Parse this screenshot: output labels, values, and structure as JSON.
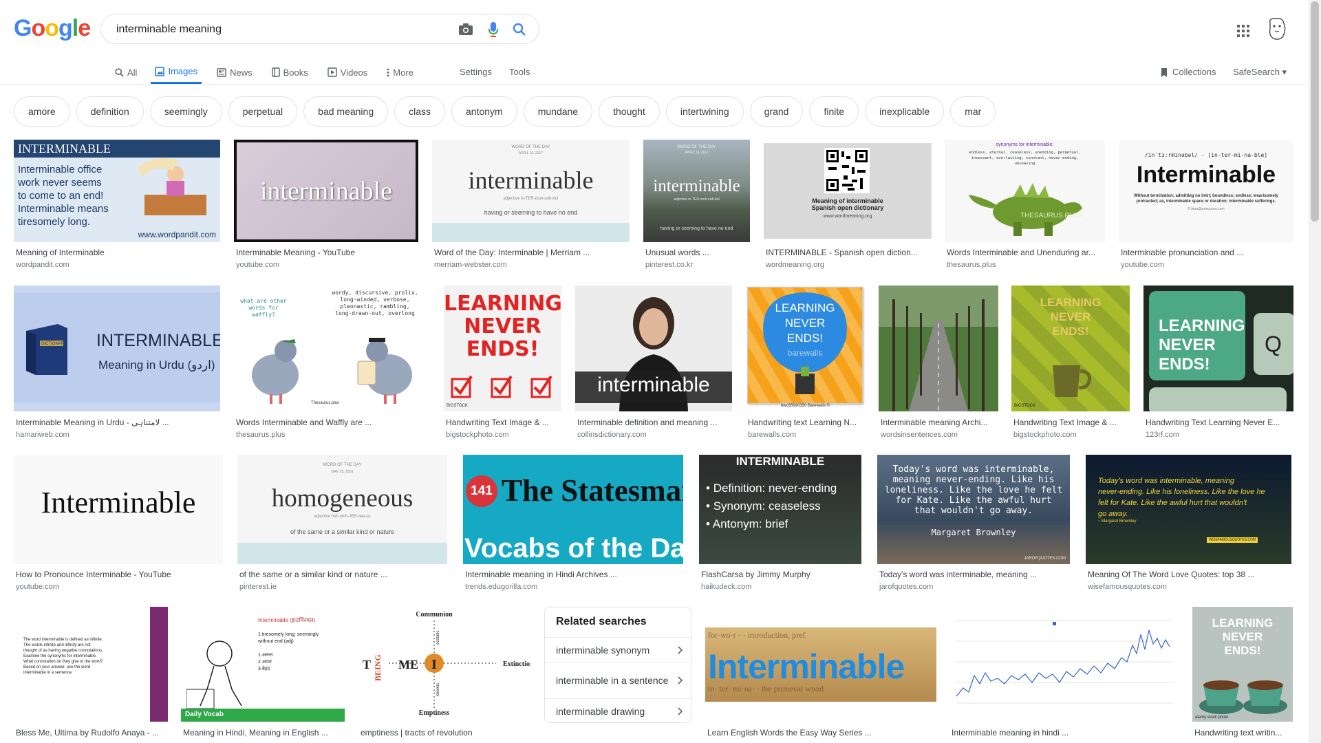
{
  "search": {
    "value": "interminable meaning"
  },
  "logo": {
    "letters": [
      "G",
      "o",
      "o",
      "g",
      "l",
      "e"
    ],
    "colors": [
      "#4285f4",
      "#ea4335",
      "#fbbc05",
      "#4285f4",
      "#34a853",
      "#ea4335"
    ]
  },
  "tabs": [
    {
      "label": "All",
      "icon": "search-icon"
    },
    {
      "label": "Images",
      "icon": "image-icon",
      "active": true
    },
    {
      "label": "News",
      "icon": "news-icon"
    },
    {
      "label": "Books",
      "icon": "book-icon"
    },
    {
      "label": "Videos",
      "icon": "video-icon"
    },
    {
      "label": "More",
      "icon": "more-vert-icon"
    }
  ],
  "toolbar": {
    "settings": "Settings",
    "tools": "Tools",
    "collections": "Collections",
    "safesearch": "SafeSearch ▾"
  },
  "chips": [
    "amore",
    "definition",
    "seemingly",
    "perpetual",
    "bad meaning",
    "class",
    "antonym",
    "mundane",
    "thought",
    "intertwining",
    "grand",
    "finite",
    "inexplicable",
    "mar"
  ],
  "results": [
    {
      "title": "Meaning of Interminable",
      "domain": "wordpandit.com",
      "thumb": {
        "heading": "INTERMINABLE",
        "lines": [
          "Interminable office",
          "work never seems",
          "to come to an end!",
          "Interminable means",
          "tiresomely long."
        ],
        "footer": "www.wordpandit.com"
      }
    },
    {
      "title": "Interminable Meaning - YouTube",
      "domain": "youtube.com",
      "thumb": {
        "word": "interminable"
      }
    },
    {
      "title": "Word of the Day: Interminable | Merriam ...",
      "domain": "merriam-webster.com",
      "thumb": {
        "top": "WORD OF THE DAY",
        "date": "APRIL 16, 2017",
        "word": "interminable",
        "pron": "adjective  in-TER-muh-nuh-bul",
        "def": "having or seeming to have no end"
      }
    },
    {
      "title": "Unusual words ...",
      "domain": "pinterest.co.kr",
      "thumb": {
        "top": "WORD OF THE DAY",
        "date": "APRIL 16, 2017",
        "word": "interminable",
        "pron": "adjective  in-TER-muh-nuh-bul",
        "def": "having or seeming to have no end"
      }
    },
    {
      "title": "INTERMINABLE - Spanish open diction...",
      "domain": "wordmeaning.org",
      "thumb": {
        "lines": [
          "Meaning of interminable",
          "Spanish open dictionary"
        ],
        "footer": "www.wordmeaning.org"
      }
    },
    {
      "title": "Words Interminable and Unenduring ar...",
      "domain": "thesaurus.plus",
      "thumb": {
        "heading": "synonyms for interminable:",
        "lines": [
          "endless, eternal, ceaseless, unending, perpetual,",
          "incessant, everlasting, constant, never-ending,",
          "unceasing"
        ],
        "footer": "THESAURUS.PLUS"
      }
    },
    {
      "title": "Interminable pronunciation and ...",
      "domain": "youtube.com",
      "thumb": {
        "pron": "/ɪnˈtɜːrmɪnəbəl/ - [in-ter-mi-na-ble]",
        "word": "Interminable",
        "def": "Without termination; admitting no limit; boundless; endless; wearisomely protracted; as, interminable space or duration; interminable sufferings.",
        "footer": "© learn2pronounce.com"
      }
    },
    {
      "title": "Interminable Meaning in Urdu - لامتناہی ...",
      "domain": "hamariweb.com",
      "thumb": {
        "book": "DICTIONARY",
        "word": "INTERMINABLE",
        "sub": "Meaning in Urdu (اردو)"
      }
    },
    {
      "title": "Words Interminable and Waffly are ...",
      "domain": "thesaurus.plus",
      "thumb": {
        "q": "what are other words for waffly?",
        "lines": [
          "wordy, discursive, prolix,",
          "long-winded, verbose,",
          "pleonastic, rambling,",
          "long-drawn-out, overlong"
        ],
        "footer": "Thesaurus.plus"
      }
    },
    {
      "title": "Handwriting Text Image & ...",
      "domain": "bigstockphoto.com",
      "thumb": {
        "lines": [
          "LEARNING",
          "NEVER",
          "ENDS!"
        ],
        "footer": "BIGSTOCK"
      }
    },
    {
      "title": "Interminable definition and meaning ...",
      "domain": "collinsdictionary.com",
      "thumb": {
        "word": "interminable"
      }
    },
    {
      "title": "Handwriting text Learning N...",
      "domain": "barewalls.com",
      "thumb": {
        "lines": [
          "LEARNING",
          "NEVER",
          "ENDS!"
        ],
        "watermark": "barewalls",
        "footer": "bwc65690350 Barewalls ©"
      }
    },
    {
      "title": "Interminable meaning Archi...",
      "domain": "wordsinsentences.com",
      "thumb": {}
    },
    {
      "title": "Handwriting Text Image & ...",
      "domain": "bigstockphoto.com",
      "thumb": {
        "lines": [
          "LEARNING",
          "NEVER",
          "ENDS!"
        ],
        "footer": "BIGSTOCK"
      }
    },
    {
      "title": "Handwriting Text Learning Never E...",
      "domain": "123rf.com",
      "thumb": {
        "lines": [
          "LEARNING",
          "NEVER",
          "ENDS!"
        ],
        "key": "Q"
      }
    },
    {
      "title": "How to Pronounce Interminable - YouTube",
      "domain": "youtube.com",
      "thumb": {
        "word": "Interminable"
      }
    },
    {
      "title": "of the same or a similar kind or nature ...",
      "domain": "pinterest.ie",
      "thumb": {
        "top": "WORD OF THE DAY",
        "date": "MAY 25, 2018",
        "word": "homogeneous",
        "pron": "adjective  hoh-muh-JEE-nee-us",
        "def": "of the same or a similar kind or nature"
      }
    },
    {
      "title": "Interminable meaning in Hindi Archives ...",
      "domain": "trends.edugorilla.com",
      "thumb": {
        "num": "141",
        "word": "The Statesman",
        "sub": "Vocabs of the Day"
      }
    },
    {
      "title": "FlashCarsa by Jimmy Murphy",
      "domain": "haikudeck.com",
      "thumb": {
        "heading": "INTERMINABLE",
        "lines": [
          "Definition: never-ending",
          "Synonym: ceaseless",
          "Antonym: brief"
        ]
      }
    },
    {
      "title": "Today's word was interminable, meaning ...",
      "domain": "jarofquotes.com",
      "thumb": {
        "lines": [
          "Today's word was interminable,",
          "meaning never-ending. Like his",
          "loneliness. Like the love he felt",
          "for Kate. Like the awful hurt",
          "that wouldn't go away."
        ],
        "author": "Margaret Brownley",
        "footer": "JAROFQUOTES.COM"
      }
    },
    {
      "title": "Meaning Of The Word Love Quotes: top 38 ...",
      "domain": "wisefamousquotes.com",
      "thumb": {
        "lines": [
          "Today's word was interminable, meaning",
          "never-ending. Like his loneliness. Like the love he",
          "felt for Kate. Like the awful hurt that wouldn't",
          "go away."
        ],
        "author": "~ Margaret Brownley",
        "footer": "WISEFAMOUSQUOTES.COM"
      }
    },
    {
      "title": "Bless Me, Ultima by Rudolfo Anaya - ...",
      "domain": "",
      "thumb": {
        "lines": [
          "The word interminable is defined as infinite.",
          "The words infinite and infinity are not",
          "thought of as having negative connotations.",
          "Examine the synonyms for interminable.",
          "What connotation do they give to the word?",
          "Based on your answer, use the word",
          "interminable in a sentence."
        ]
      }
    },
    {
      "title": "Meaning in Hindi, Meaning in English ...",
      "domain": "",
      "thumb": {
        "heading": "Interminable (इन्टर्मिनबल)",
        "lines": [
          "1.tiresomely long; seemingly",
          "without end (adj)",
          "1.अनन्त",
          "2.अपार",
          "3.बेहद"
        ],
        "footer": "Daily Vocab"
      }
    },
    {
      "title": "emptiness | tracts of revolution",
      "domain": "",
      "thumb": {
        "top": "Communion",
        "left": "BEING",
        "t": "T",
        "me": "ME",
        "right": "Extinction",
        "bottom": "Emptiness",
        "i": "I",
        "vt": "ecstatic",
        "vb": "kenotic"
      }
    },
    {
      "title": "Learn English Words the Easy Way Series ...",
      "domain": "",
      "thumb": {
        "word": "Interminable"
      }
    },
    {
      "title": "Interminable meaning in hindi ...",
      "domain": "",
      "thumb": {}
    },
    {
      "title": "Handwriting text writin...",
      "domain": "",
      "thumb": {
        "lines": [
          "LEARNING",
          "NEVER",
          "ENDS!"
        ],
        "footer": "alamy stock photo"
      }
    }
  ],
  "related": {
    "title": "Related searches",
    "items": [
      "interminable synonym",
      "interminable in a sentence",
      "interminable drawing"
    ]
  }
}
